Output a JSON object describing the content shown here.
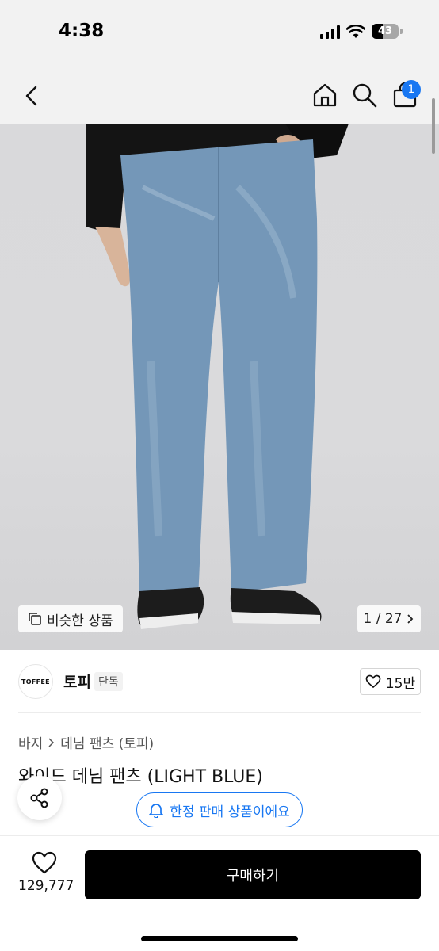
{
  "status_bar": {
    "time": "4:38",
    "battery": "43"
  },
  "nav": {
    "cart_count": "1"
  },
  "image": {
    "similar_label": "비슷한 상품",
    "pager": "1 / 27"
  },
  "brand": {
    "logo_text": "TOFFEE",
    "name": "토피",
    "tag": "단독",
    "likes": "15만"
  },
  "product": {
    "breadcrumb": [
      "바지",
      "데님 팬츠 (토피)"
    ],
    "title": "와이드 데님 팬츠 (LIGHT BLUE)",
    "limited_label": "한정 판매 상품이에요"
  },
  "bottom_bar": {
    "wish_count": "129,777",
    "buy_label": "구매하기"
  },
  "colors": {
    "accent": "#1877f2",
    "buy_button": "#000000",
    "jeans": "#7497b8"
  }
}
